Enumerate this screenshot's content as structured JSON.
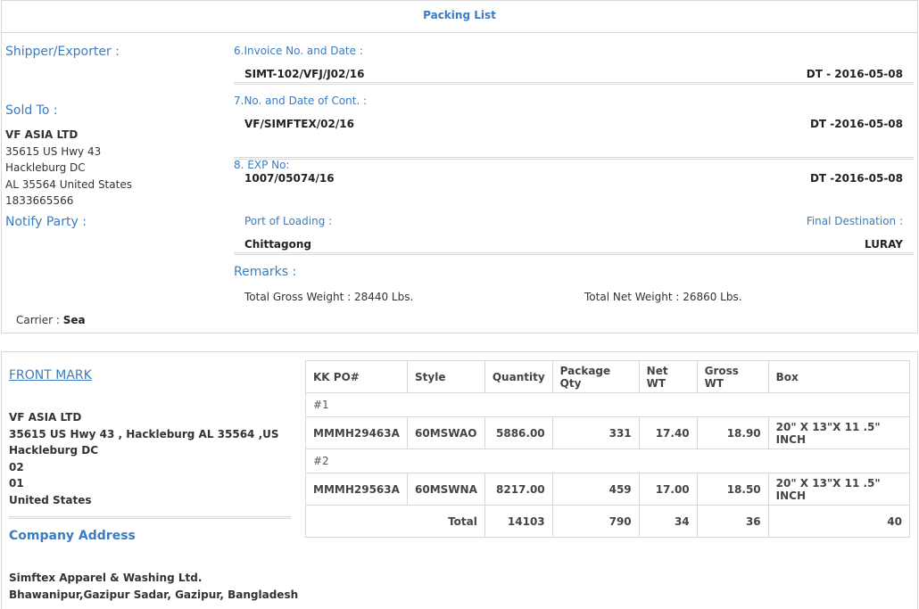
{
  "title": "Packing List",
  "left": {
    "shipper_label": "Shipper/Exporter :",
    "sold_to_label": "Sold To :",
    "sold_to_name": "VF ASIA LTD",
    "sold_to_lines": [
      "35615 US Hwy 43",
      "Hackleburg DC",
      "AL 35564 United States",
      "1833665566"
    ],
    "notify_label": "Notify Party :",
    "carrier_label": "Carrier :",
    "carrier_value": "Sea"
  },
  "invoice": {
    "label": "6.Invoice No. and Date :",
    "number": "SIMT-102/VFJ/J02/16",
    "date": "DT - 2016-05-08"
  },
  "contract": {
    "label": "7.No. and Date of Cont. :",
    "number": "VF/SIMFTEX/02/16",
    "date": "DT -2016-05-08"
  },
  "exp": {
    "label": "8. EXP No:",
    "number": "1007/05074/16",
    "date": "DT -2016-05-08"
  },
  "port": {
    "loading_label": "Port of Loading :",
    "loading_value": "Chittagong",
    "destination_label": "Final Destination :",
    "destination_value": "LURAY"
  },
  "remarks": {
    "label": "Remarks :",
    "gross": "Total Gross Weight : 28440 Lbs.",
    "net": "Total Net Weight : 26860 Lbs."
  },
  "front_mark": {
    "label": "FRONT MARK",
    "lines": [
      "VF ASIA LTD",
      "35615 US Hwy 43 , Hackleburg AL 35564 ,US",
      "Hackleburg DC",
      "02",
      "01",
      "United States"
    ]
  },
  "company": {
    "label": "Company Address",
    "name": "Simftex Apparel & Washing Ltd.",
    "address": "Bhawanipur,Gazipur Sadar, Gazipur, Bangladesh"
  },
  "table": {
    "headers": [
      "KK PO#",
      "Style",
      "Quantity",
      "Package Qty",
      "Net WT",
      "Gross WT",
      "Box"
    ],
    "groups": [
      {
        "label": "#1",
        "row": [
          "MMMH29463A",
          "60MSWAO",
          "5886.00",
          "331",
          "17.40",
          "18.90",
          "20\" X 13\"X 11 .5\" INCH"
        ]
      },
      {
        "label": "#2",
        "row": [
          "MMMH29563A",
          "60MSWNA",
          "8217.00",
          "459",
          "17.00",
          "18.50",
          "20\" X 13\"X 11 .5\" INCH"
        ]
      }
    ],
    "total": {
      "label": "Total",
      "quantity": "14103",
      "package": "790",
      "net": "34",
      "gross": "36",
      "box": "40"
    }
  }
}
